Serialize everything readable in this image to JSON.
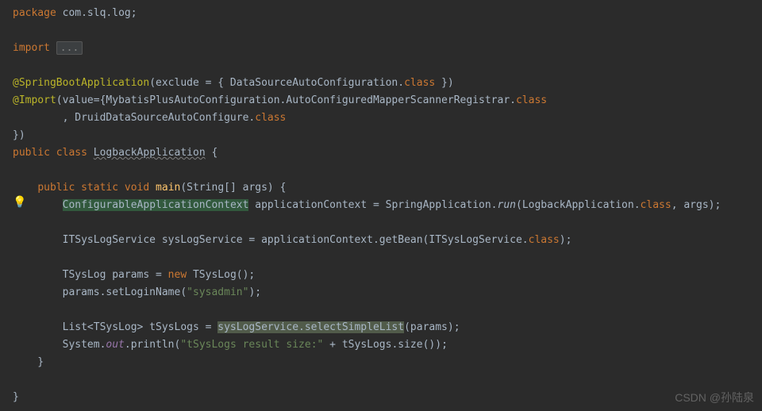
{
  "code": {
    "pkg_kw": "package",
    "pkg_name": " com.slq.log;",
    "import_kw": "import",
    "import_fold": "...",
    "ann1": "@SpringBootApplication",
    "ann1_args1": "(exclude = { DataSourceAutoConfiguration.",
    "ann1_class": "class",
    "ann1_args2": " })",
    "ann2": "@Import",
    "ann2_args1": "(value={MybatisPlusAutoConfiguration.AutoConfiguredMapperScannerRegistrar.",
    "ann2_class1": "class",
    "ann2_line2_comma": "        , DruidDataSourceAutoConfigure.",
    "ann2_class2": "class",
    "ann_close": "})",
    "public": "public",
    "class_kw": "class",
    "class_name": "LogbackApplication",
    "open_brace": " {",
    "static_kw": "static",
    "void_kw": "void",
    "main_name": "main",
    "main_args": "(String[] args) {",
    "ctx_type": "ConfigurableApplicationContext",
    "ctx_var": " applicationContext = SpringApplication.",
    "run_method": "run",
    "ctx_rest1": "(LogbackApplication.",
    "ctx_class": "class",
    "ctx_rest2": ", args);",
    "svc_line1": "        ITSysLogService sysLogService = applicationContext.getBean(ITSysLogService.",
    "svc_class": "class",
    "svc_line1_end": ");",
    "params_type": "        TSysLog params = ",
    "new_kw": "new",
    "params_ctor": " TSysLog();",
    "set_login": "        params.setLoginName(",
    "sysadmin_str": "\"sysadmin\"",
    "set_login_end": ");",
    "list_line1": "        List<TSysLog> tSysLogs = ",
    "list_sel": "sysLogService.selectSimpleList",
    "list_line1_end": "(params);",
    "sout_sys": "        System.",
    "sout_out": "out",
    "sout_print": ".println(",
    "sout_str": "\"tSysLogs result size:\"",
    "sout_end": " + tSysLogs.size());",
    "close_brace1": "    }",
    "close_brace2": "}",
    "indent4": "    ",
    "indent8": "        "
  },
  "watermark": "CSDN @孙陆泉"
}
